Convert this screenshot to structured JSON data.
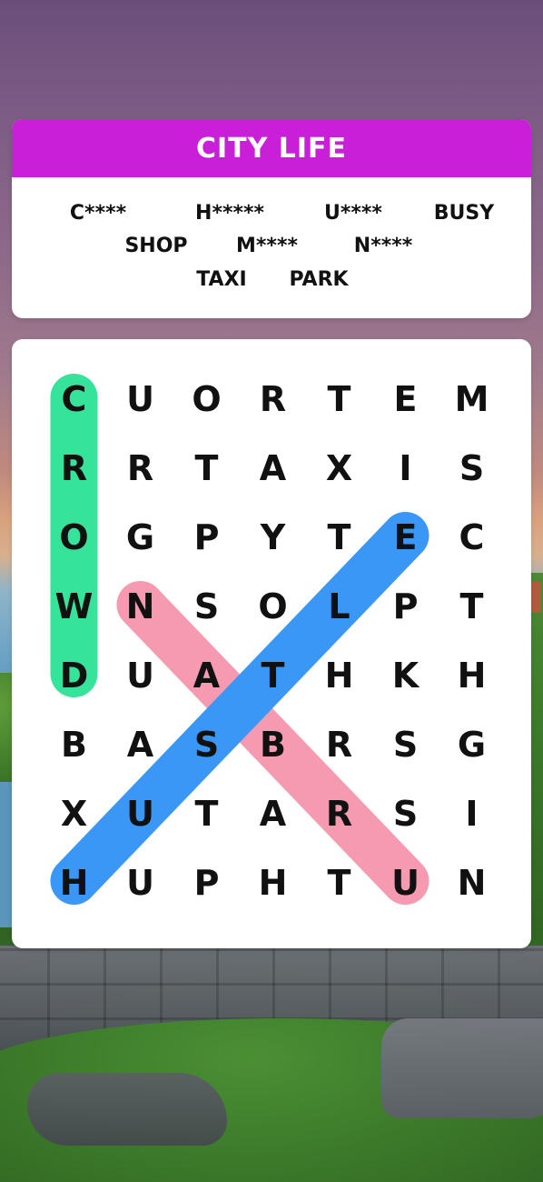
{
  "game": {
    "title": "CITY LIFE",
    "title_color": "#c91fd8",
    "words": [
      {
        "text": "C****",
        "found": false
      },
      {
        "text": "H*****",
        "found": false
      },
      {
        "text": "U****",
        "found": false
      },
      {
        "text": "BUSY",
        "found": false
      },
      {
        "text": "SHOP",
        "found": false
      },
      {
        "text": "M****",
        "found": false
      },
      {
        "text": "N****",
        "found": false
      },
      {
        "text": "TAXI",
        "found": false
      },
      {
        "text": "PARK",
        "found": false
      }
    ],
    "grid": [
      [
        "C",
        "U",
        "O",
        "R",
        "T",
        "E",
        "M"
      ],
      [
        "R",
        "R",
        "T",
        "A",
        "X",
        "I",
        "S"
      ],
      [
        "O",
        "G",
        "P",
        "Y",
        "T",
        "E",
        "C"
      ],
      [
        "W",
        "N",
        "S",
        "O",
        "L",
        "P",
        "T"
      ],
      [
        "D",
        "U",
        "A",
        "T",
        "H",
        "K",
        "H"
      ],
      [
        "B",
        "A",
        "S",
        "B",
        "R",
        "S",
        "G"
      ],
      [
        "X",
        "U",
        "T",
        "A",
        "R",
        "S",
        "I"
      ],
      [
        "H",
        "U",
        "P",
        "H",
        "T",
        "U",
        "N"
      ]
    ],
    "highlights": [
      {
        "name": "highlight-crowd",
        "color": "#36e39a",
        "from": [
          0,
          0
        ],
        "to": [
          4,
          0
        ]
      },
      {
        "name": "highlight-nature",
        "color": "#f59ab1",
        "from": [
          3,
          1
        ],
        "to": [
          7,
          5
        ]
      },
      {
        "name": "highlight-health",
        "color": "#3b97f5",
        "from": [
          2,
          5
        ],
        "to": [
          7,
          0
        ]
      }
    ]
  }
}
